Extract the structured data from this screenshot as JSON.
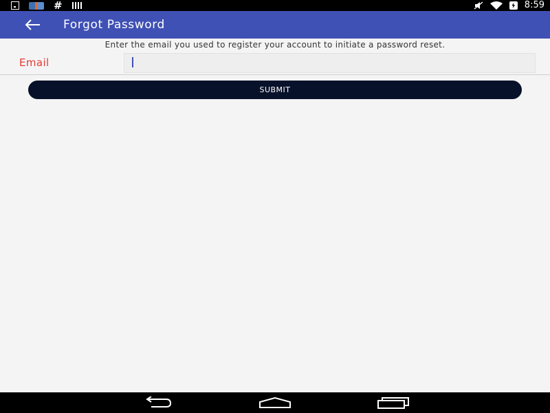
{
  "status_bar": {
    "time": "8:59",
    "left_icons": [
      "download-icon",
      "app-thumbnail-icon",
      "hash-icon",
      "signal-bars-icon"
    ],
    "right_icons": [
      "mute-icon",
      "wifi-icon",
      "battery-charging-icon"
    ]
  },
  "app_bar": {
    "title": "Forgot Password",
    "back_icon": "arrow-left-icon",
    "color": "#3f51b5"
  },
  "form": {
    "instruction": "Enter the email you used to register your account to initiate a password reset.",
    "email_label": "Email",
    "email_value": "",
    "email_placeholder": "",
    "submit_label": "SUBMIT",
    "label_color": "#e53935",
    "button_color": "#08112a"
  },
  "nav_bar": {
    "icons": [
      "nav-back-icon",
      "nav-home-icon",
      "nav-recents-icon"
    ]
  }
}
